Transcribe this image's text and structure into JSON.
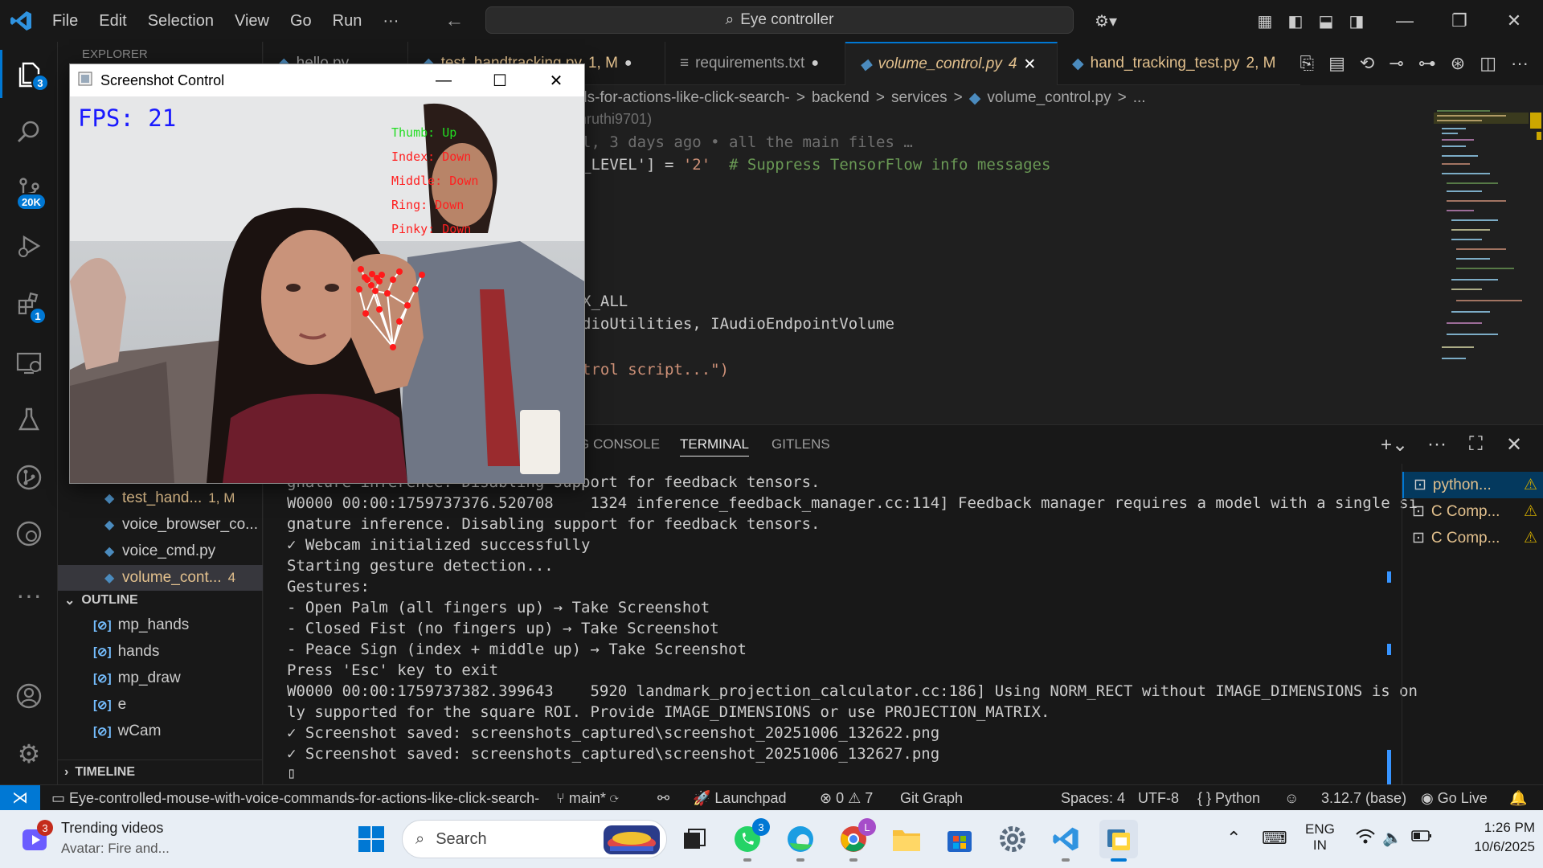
{
  "titlebar": {
    "menu": [
      "File",
      "Edit",
      "Selection",
      "View",
      "Go",
      "Run",
      "···"
    ],
    "command_center": "Eye controller"
  },
  "activity": {
    "explorer_badge": "3",
    "scm_badge": "20K",
    "extensions_badge": "1"
  },
  "sidebar": {
    "header_peek": "EXPLORER",
    "files": [
      {
        "label": "test_hand...",
        "status": "1, M"
      },
      {
        "label": "voice_browser_co...",
        "status": ""
      },
      {
        "label": "voice_cmd.py",
        "status": ""
      },
      {
        "label": "volume_cont...",
        "status": "4"
      }
    ],
    "outline_title": "OUTLINE",
    "outline": [
      "mp_hands",
      "hands",
      "mp_draw",
      "e",
      "wCam"
    ],
    "timeline_title": "TIMELINE"
  },
  "tabs": [
    {
      "label": "hello.py",
      "status": "",
      "dot": false
    },
    {
      "label": "test_handtracking.py",
      "status": "1, M",
      "dot": true
    },
    {
      "label": "requirements.txt",
      "status": "",
      "dot": true
    },
    {
      "label": "volume_control.py",
      "status": "4",
      "dot": false,
      "close": "✕"
    },
    {
      "label": "hand_tracking_test.py",
      "status": "2, M",
      "dot": false
    }
  ],
  "breadcrumb": {
    "folder_tail": "ds-for-actions-like-click-search-",
    "sep": ">",
    "parts": [
      "backend",
      "services",
      "volume_control.py",
      "..."
    ]
  },
  "blame": {
    "author_tail": "hruthi9701)",
    "line": "l, 3 days ago • all the main files …"
  },
  "code": {
    "line1_a": "_LEVEL'] = ",
    "line1_str": "'2'",
    "line1_com": "  # Suppress TensorFlow info messages",
    "line2": "X_ALL",
    "line3": "dioUtilities, IAudioEndpointVolume",
    "line4_str": "trol script...\")"
  },
  "panel": {
    "tabs": [
      "G CONSOLE",
      "TERMINAL",
      "GITLENS"
    ],
    "terminal_lines": [
      "gnature inference. Disabling support for feedback tensors.",
      "W0000 00:00:1759737376.520708    1324 inference_feedback_manager.cc:114] Feedback manager requires a model with a single si",
      "gnature inference. Disabling support for feedback tensors.",
      "✓ Webcam initialized successfully",
      "Starting gesture detection...",
      "Gestures:",
      "- Open Palm (all fingers up) → Take Screenshot",
      "- Closed Fist (no fingers up) → Take Screenshot",
      "- Peace Sign (index + middle up) → Take Screenshot",
      "Press 'Esc' key to exit",
      "W0000 00:00:1759737382.399643    5920 landmark_projection_calculator.cc:186] Using NORM_RECT without IMAGE_DIMENSIONS is on",
      "ly supported for the square ROI. Provide IMAGE_DIMENSIONS or use PROJECTION_MATRIX.",
      "✓ Screenshot saved: screenshots_captured\\screenshot_20251006_132622.png",
      "✓ Screenshot saved: screenshots_captured\\screenshot_20251006_132627.png"
    ],
    "cursor": "▯",
    "terminals": [
      "python...",
      "C Comp...",
      "C Comp..."
    ]
  },
  "statusbar": {
    "folder": "Eye-controlled-mouse-with-voice-commands-for-actions-like-click-search-",
    "branch": "main*",
    "launchpad": "Launchpad",
    "problems": "⊗ 0 ⚠ 7",
    "gitgraph": "Git Graph",
    "spaces": "Spaces: 4",
    "encoding": "UTF-8",
    "lang": "{ } Python",
    "interpreter": "3.12.7 (base)",
    "golive": "Go Live"
  },
  "floating_window": {
    "title": "Screenshot Control",
    "fps": "FPS: 21",
    "fingers": [
      "Thumb: Up",
      "Index: Down",
      "Middle: Down",
      "Ring: Down",
      "Pinky: Down"
    ]
  },
  "taskbar": {
    "widget_title": "Trending videos",
    "widget_sub": "Avatar: Fire and...",
    "widget_badge": "3",
    "search": "Search",
    "whatsapp_badge": "3",
    "chrome_badge": "L",
    "lang1": "ENG",
    "lang2": "IN",
    "time": "1:26 PM",
    "date": "10/6/2025"
  },
  "colors": {
    "accent": "#0078d4",
    "modified": "#e2c08d",
    "warning": "#cca700",
    "overlay_red": "#ff2020",
    "overlay_green": "#22dd22",
    "fps_blue": "#1a1aff"
  }
}
